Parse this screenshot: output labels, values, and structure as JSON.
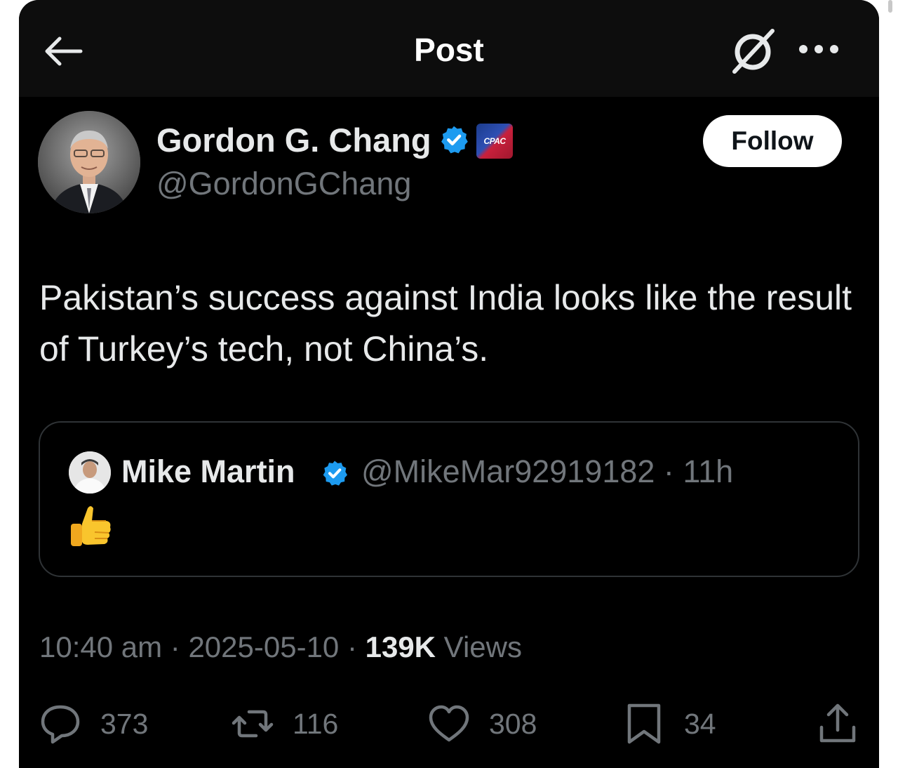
{
  "header": {
    "title": "Post",
    "back_icon": "arrow-left-icon",
    "grok_icon": "grok-icon",
    "more_icon": "more-icon"
  },
  "author": {
    "name": "Gordon G. Chang",
    "handle": "@GordonGChang",
    "verified": true,
    "affiliation_badge": "CPAC",
    "follow_label": "Follow"
  },
  "post": {
    "text": "Pakistan’s success against India looks like the result of Turkey’s tech, not China’s."
  },
  "quoted": {
    "name": "Mike Martin",
    "handle_time": "@MikeMar92919182 · 11h",
    "verified": true,
    "emoji": "thumbs-up-icon"
  },
  "meta": {
    "time_date": "10:40 am · 2025-05-10 · ",
    "views_count": "139K",
    "views_label": " Views"
  },
  "actions": {
    "replies": "373",
    "reposts": "116",
    "likes": "308",
    "bookmarks": "34"
  },
  "colors": {
    "background": "#000000",
    "text_primary": "#e7e9ea",
    "text_secondary": "#71767b",
    "verified_blue": "#1d9bf0",
    "border": "#2f3336"
  }
}
